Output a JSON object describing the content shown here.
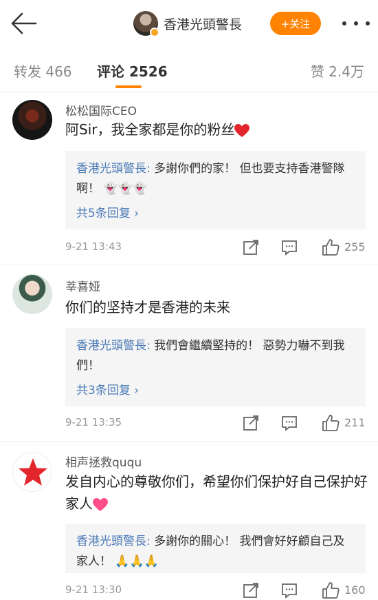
{
  "header": {
    "user_name": "香港光頭警長",
    "follow_label": "+关注"
  },
  "tabs": {
    "repost": "转发 466",
    "comment": "评论 2526",
    "like": "赞 2.4万"
  },
  "comments": [
    {
      "name": "松松国际CEO",
      "text": "阿Sir，我全家都是你的粉丝",
      "reply_author": "香港光頭警長:",
      "reply_text": " 多謝你們的家！ 但也要支持香港警隊啊！",
      "reply_more": "共5条回复 ›",
      "time": "9-21 13:43",
      "likes": "255"
    },
    {
      "name": "莘喜娅",
      "text": "你们的坚持才是香港的未来",
      "reply_author": "香港光頭警長:",
      "reply_text": " 我們會繼續堅持的！ 惡勢力嚇不到我們！",
      "reply_more": "共3条回复 ›",
      "time": "9-21 13:35",
      "likes": "211"
    },
    {
      "name": "相声拯救ququ",
      "text": "发自内心的尊敬你们，希望你们保护好自己保护好家人",
      "reply_author": "香港光頭警長:",
      "reply_text": " 多謝你的關心！ 我們會好好顧自己及家人！",
      "time": "9-21 13:30",
      "likes": "160"
    }
  ],
  "colors": {
    "accent": "#ff8200",
    "link": "#4a7ab7"
  }
}
